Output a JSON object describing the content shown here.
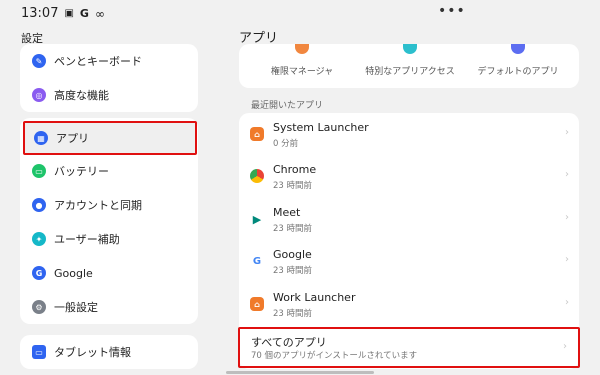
{
  "status_bar": {
    "time": "13:07",
    "icons": [
      "notification-icon",
      "google-icon",
      "infinity-icon"
    ],
    "overflow": "•••"
  },
  "settings": {
    "title": "設定",
    "group1": [
      {
        "label": "ペンとキーボード",
        "icon": "pen-icon",
        "color": "#2f64f0"
      },
      {
        "label": "高度な機能",
        "icon": "feature-icon",
        "color": "#8a5bf0"
      }
    ],
    "group2": [
      {
        "label": "アプリ",
        "icon": "apps-icon",
        "color": "#2f64f0",
        "selected": true
      },
      {
        "label": "バッテリー",
        "icon": "battery-icon",
        "color": "#1ec46a"
      },
      {
        "label": "アカウントと同期",
        "icon": "account-icon",
        "color": "#2f64f0"
      },
      {
        "label": "ユーザー補助",
        "icon": "accessibility-icon",
        "color": "#15b8c8"
      },
      {
        "label": "Google",
        "icon": "google-icon",
        "color": "#2f64f0"
      },
      {
        "label": "一般設定",
        "icon": "gear-icon",
        "color": "#7a8089"
      }
    ],
    "group3": [
      {
        "label": "タブレット情報",
        "icon": "tablet-icon",
        "color": "#2f64f0"
      }
    ]
  },
  "apps_page": {
    "title": "アプリ",
    "quick_actions": [
      {
        "label": "権限マネージャ",
        "color": "#f07a2a"
      },
      {
        "label": "特別なアプリアクセス",
        "color": "#15b8c8"
      },
      {
        "label": "デフォルトのアプリ",
        "color": "#4a5df0"
      }
    ],
    "recent_label": "最近開いたアプリ",
    "recent_apps": [
      {
        "name": "System Launcher",
        "sub": "0 分前",
        "icon": "launcher-icon"
      },
      {
        "name": "Chrome",
        "sub": "23 時間前",
        "icon": "chrome-icon"
      },
      {
        "name": "Meet",
        "sub": "23 時間前",
        "icon": "meet-icon"
      },
      {
        "name": "Google",
        "sub": "23 時間前",
        "icon": "google-icon"
      },
      {
        "name": "Work Launcher",
        "sub": "23 時間前",
        "icon": "launcher-icon"
      }
    ],
    "all_apps": {
      "title": "すべてのアプリ",
      "sub": "70 個のアプリがインストールされています"
    }
  }
}
